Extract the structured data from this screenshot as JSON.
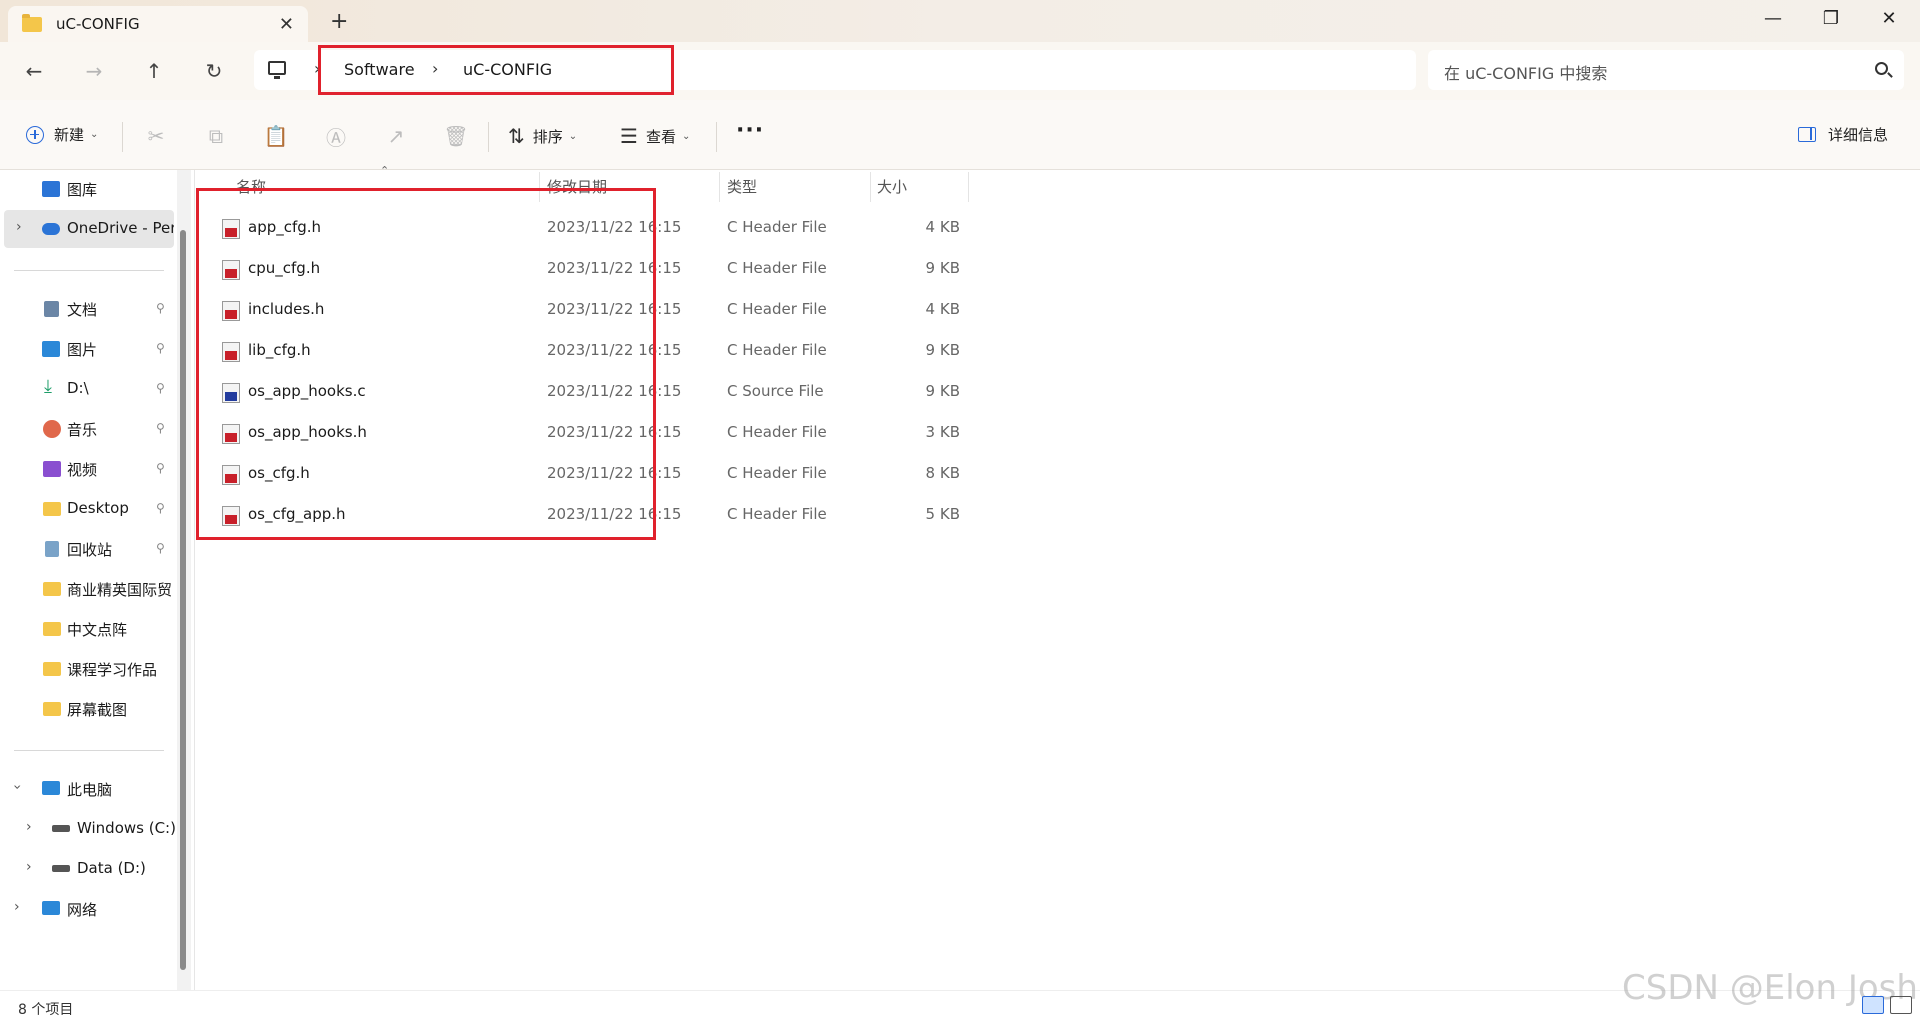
{
  "window": {
    "tab_title": "uC-CONFIG",
    "close_tab": "✕",
    "new_tab": "+",
    "minimize": "—",
    "restore": "❐",
    "close": "✕"
  },
  "nav": {
    "back": "←",
    "forward": "→",
    "up": "↑",
    "refresh": "↻",
    "breadcrumb": [
      "Software",
      "uC-CONFIG"
    ],
    "crumb_sep": "›",
    "search_placeholder": "在 uC-CONFIG 中搜索"
  },
  "toolbar": {
    "new_label": "新建",
    "sort_label": "排序",
    "view_label": "查看",
    "more": "···",
    "details_label": "详细信息",
    "caret": "⌄"
  },
  "sidebar": {
    "items": [
      {
        "label": "图库",
        "icon": "gallery-icon",
        "color": "#2b74d6"
      },
      {
        "label": "OneDrive - Per",
        "icon": "onedrive-icon",
        "color": "#2b74d6",
        "selected": true
      },
      {
        "label": "文档",
        "icon": "documents-icon",
        "color": "#6b86a6",
        "pinned": true
      },
      {
        "label": "图片",
        "icon": "pictures-icon",
        "color": "#2b88d8",
        "pinned": true
      },
      {
        "label": "D:\\",
        "icon": "download-icon",
        "color": "#1f9e6a",
        "pinned": true
      },
      {
        "label": "音乐",
        "icon": "music-icon",
        "color": "#e0684b",
        "pinned": true
      },
      {
        "label": "视频",
        "icon": "video-icon",
        "color": "#8a4fd0",
        "pinned": true
      },
      {
        "label": "Desktop",
        "icon": "folder-icon",
        "color": "#f4c64a",
        "pinned": true
      },
      {
        "label": "回收站",
        "icon": "recycle-bin-icon",
        "color": "#7aa3c8",
        "pinned": true
      },
      {
        "label": "商业精英国际贸",
        "icon": "folder-icon",
        "color": "#f4c64a"
      },
      {
        "label": "中文点阵",
        "icon": "folder-icon",
        "color": "#f4c64a"
      },
      {
        "label": "课程学习作品",
        "icon": "folder-icon",
        "color": "#f4c64a"
      },
      {
        "label": "屏幕截图",
        "icon": "folder-icon",
        "color": "#f4c64a"
      },
      {
        "label": "此电脑",
        "icon": "this-pc-icon",
        "color": "#2b88d8"
      },
      {
        "label": "Windows (C:)",
        "icon": "drive-icon",
        "color": "#555555"
      },
      {
        "label": "Data (D:)",
        "icon": "drive-icon",
        "color": "#555555"
      },
      {
        "label": "网络",
        "icon": "network-icon",
        "color": "#2b88d8"
      }
    ],
    "pin": "📌"
  },
  "columns": {
    "name": "名称",
    "modified": "修改日期",
    "type": "类型",
    "size": "大小"
  },
  "files": [
    {
      "name": "app_cfg.h",
      "modified": "2023/11/22 16:15",
      "type": "C Header File",
      "size": "4 KB",
      "kind": "header"
    },
    {
      "name": "cpu_cfg.h",
      "modified": "2023/11/22 16:15",
      "type": "C Header File",
      "size": "9 KB",
      "kind": "header"
    },
    {
      "name": "includes.h",
      "modified": "2023/11/22 16:15",
      "type": "C Header File",
      "size": "4 KB",
      "kind": "header"
    },
    {
      "name": "lib_cfg.h",
      "modified": "2023/11/22 16:15",
      "type": "C Header File",
      "size": "9 KB",
      "kind": "header"
    },
    {
      "name": "os_app_hooks.c",
      "modified": "2023/11/22 16:15",
      "type": "C Source File",
      "size": "9 KB",
      "kind": "source"
    },
    {
      "name": "os_app_hooks.h",
      "modified": "2023/11/22 16:15",
      "type": "C Header File",
      "size": "3 KB",
      "kind": "header"
    },
    {
      "name": "os_cfg.h",
      "modified": "2023/11/22 16:15",
      "type": "C Header File",
      "size": "8 KB",
      "kind": "header"
    },
    {
      "name": "os_cfg_app.h",
      "modified": "2023/11/22 16:15",
      "type": "C Header File",
      "size": "5 KB",
      "kind": "header"
    }
  ],
  "status": {
    "item_count": "8 个项目",
    "watermark": "CSDN @Elon Josh"
  },
  "colors": {
    "highlight_box": "#e0212c",
    "accent": "#2a6ad9"
  }
}
